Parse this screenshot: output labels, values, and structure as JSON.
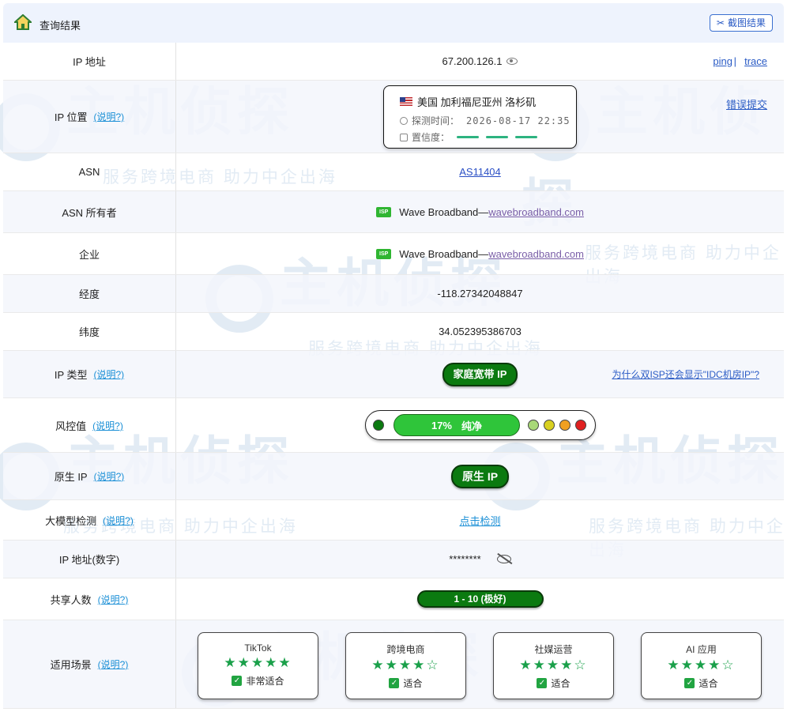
{
  "header": {
    "title": "查询结果",
    "screenshot_button": "截图结果"
  },
  "watermark": {
    "logo": "主机侦探",
    "slogan": "服务跨境电商 助力中企出海"
  },
  "rows": {
    "ip": {
      "label": "IP 地址",
      "value": "67.200.126.1",
      "link_ping": "ping",
      "separator": "|",
      "link_trace": "trace"
    },
    "location": {
      "label": "IP 位置",
      "help": "(说明?)",
      "place": "美国 加利福尼亚州 洛杉矶",
      "time_label": "探测时间：",
      "time_value": "2026-08-17 22:35",
      "confidence_label": "置信度：",
      "error_link": "错误提交"
    },
    "asn": {
      "label": "ASN",
      "value": "AS11404"
    },
    "asn_owner": {
      "label": "ASN 所有者",
      "badge": "ISP",
      "name": "Wave Broadband—",
      "domain": "wavebroadband.com"
    },
    "company": {
      "label": "企业",
      "badge": "ISP",
      "name": "Wave Broadband—",
      "domain": "wavebroadband.com"
    },
    "longitude": {
      "label": "经度",
      "value": "-118.27342048847"
    },
    "latitude": {
      "label": "纬度",
      "value": "34.052395386703"
    },
    "ip_type": {
      "label": "IP 类型",
      "help": "(说明?)",
      "value": "家庭宽带 IP",
      "question_link": "为什么双ISP还会显示\"IDC机房IP\"?"
    },
    "risk": {
      "label": "风控值",
      "help": "(说明?)",
      "percent": "17%",
      "status": "纯净",
      "dot_colors": [
        "#0b7a10",
        "#a8d878",
        "#d8d020",
        "#f0a020",
        "#e02020"
      ]
    },
    "native_ip": {
      "label": "原生 IP",
      "help": "(说明?)",
      "value": "原生 IP"
    },
    "llm_check": {
      "label": "大模型检测",
      "help": "(说明?)",
      "link": "点击检测"
    },
    "ip_numeric": {
      "label": "IP 地址(数字)",
      "value": "********"
    },
    "shared_users": {
      "label": "共享人数",
      "help": "(说明?)",
      "value": "1 - 10 (极好)"
    },
    "scenarios": {
      "label": "适用场景",
      "help": "(说明?)",
      "items": [
        {
          "name": "TikTok",
          "stars": "★★★★★",
          "fit": "非常适合"
        },
        {
          "name": "跨境电商",
          "stars": "★★★★☆",
          "fit": "适合"
        },
        {
          "name": "社媒运营",
          "stars": "★★★★☆",
          "fit": "适合"
        },
        {
          "name": "AI 应用",
          "stars": "★★★★☆",
          "fit": "适合"
        }
      ]
    }
  },
  "colors": {
    "accent_blue": "#2a5bc5",
    "pure_green": "#0b7a10",
    "star_green": "#1aa04a"
  }
}
